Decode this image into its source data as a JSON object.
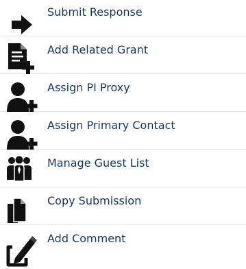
{
  "colors": {
    "link_text": "#16365f",
    "icon": "#111111",
    "divider": "#e6e6e6"
  },
  "actions": [
    {
      "label": "Submit Response",
      "icon": "arrow-right-icon"
    },
    {
      "label": "Add Related Grant",
      "icon": "document-add-icon"
    },
    {
      "label": "Assign PI Proxy",
      "icon": "user-add-icon"
    },
    {
      "label": "Assign Primary Contact",
      "icon": "user-add-icon"
    },
    {
      "label": "Manage Guest List",
      "icon": "group-icon"
    },
    {
      "label": "Copy Submission",
      "icon": "copy-documents-icon"
    },
    {
      "label": "Add Comment",
      "icon": "pen-comment-icon"
    }
  ]
}
